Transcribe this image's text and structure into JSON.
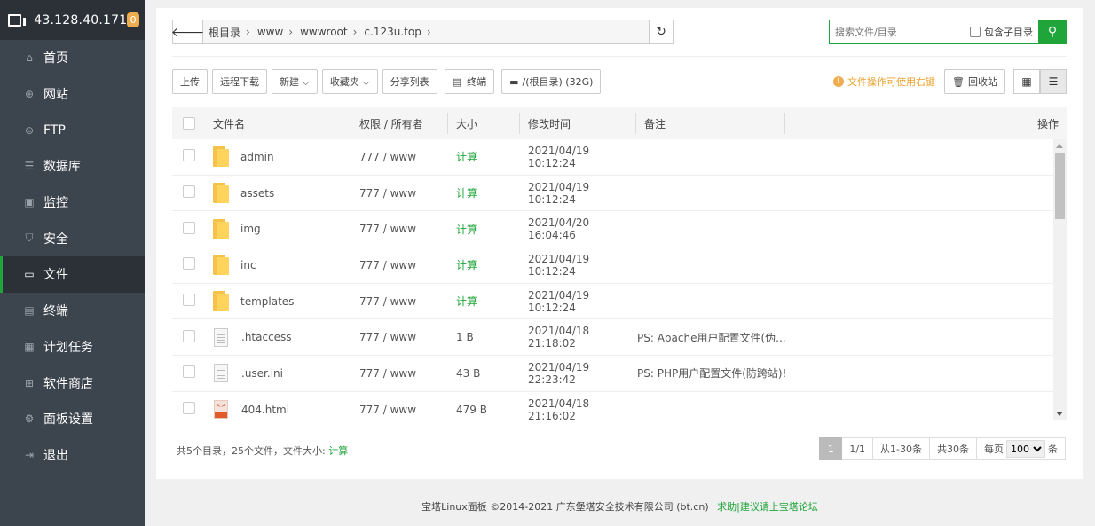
{
  "sidebar": {
    "ip": "43.128.40.171",
    "badge": "0",
    "items": [
      {
        "label": "首页",
        "icon": "home-icon",
        "glyph": "⌂"
      },
      {
        "label": "网站",
        "icon": "globe-icon",
        "glyph": "⊕"
      },
      {
        "label": "FTP",
        "icon": "ftp-icon",
        "glyph": "⊜"
      },
      {
        "label": "数据库",
        "icon": "database-icon",
        "glyph": "☰"
      },
      {
        "label": "监控",
        "icon": "monitor-icon",
        "glyph": "▣"
      },
      {
        "label": "安全",
        "icon": "shield-icon",
        "glyph": "⛉"
      },
      {
        "label": "文件",
        "icon": "folder-icon",
        "glyph": "▭"
      },
      {
        "label": "终端",
        "icon": "terminal-icon",
        "glyph": "▤"
      },
      {
        "label": "计划任务",
        "icon": "calendar-icon",
        "glyph": "▦"
      },
      {
        "label": "软件商店",
        "icon": "apps-icon",
        "glyph": "⊞"
      },
      {
        "label": "面板设置",
        "icon": "gear-icon",
        "glyph": "⚙"
      },
      {
        "label": "退出",
        "icon": "logout-icon",
        "glyph": "⇥"
      }
    ],
    "active_index": 6
  },
  "path": {
    "crumbs": [
      "根目录",
      "www",
      "wwwroot",
      "c.123u.top"
    ]
  },
  "search": {
    "placeholder": "搜索文件/目录",
    "include_sub_label": "包含子目录"
  },
  "toolbar": {
    "buttons": [
      "上传",
      "远程下载",
      "新建 ⌵",
      "收藏夹 ⌵",
      "分享列表"
    ],
    "terminal": "终端",
    "disk": "/(根目录) (32G)",
    "tip": "文件操作可使用右键",
    "recycle": "回收站"
  },
  "table": {
    "headers": {
      "name": "文件名",
      "perm": "权限 / 所有者",
      "size": "大小",
      "time": "修改时间",
      "note": "备注",
      "ops": "操作"
    },
    "rows": [
      {
        "type": "folder",
        "name": "admin",
        "perm": "777 / www",
        "size": "计算",
        "time": "2021/04/19 10:12:24",
        "note": ""
      },
      {
        "type": "folder",
        "name": "assets",
        "perm": "777 / www",
        "size": "计算",
        "time": "2021/04/19 10:12:24",
        "note": ""
      },
      {
        "type": "folder",
        "name": "img",
        "perm": "777 / www",
        "size": "计算",
        "time": "2021/04/20 16:04:46",
        "note": ""
      },
      {
        "type": "folder",
        "name": "inc",
        "perm": "777 / www",
        "size": "计算",
        "time": "2021/04/19 10:12:24",
        "note": ""
      },
      {
        "type": "folder",
        "name": "templates",
        "perm": "777 / www",
        "size": "计算",
        "time": "2021/04/19 10:12:24",
        "note": ""
      },
      {
        "type": "file",
        "name": ".htaccess",
        "perm": "777 / www",
        "size": "1 B",
        "time": "2021/04/18 21:18:02",
        "note": "PS: Apache用户配置文件(伪..."
      },
      {
        "type": "file",
        "name": ".user.ini",
        "perm": "777 / www",
        "size": "43 B",
        "time": "2021/04/19 22:23:42",
        "note": "PS: PHP用户配置文件(防跨站)!"
      },
      {
        "type": "html",
        "name": "404.html",
        "perm": "777 / www",
        "size": "479 B",
        "time": "2021/04/18 21:16:02",
        "note": ""
      }
    ]
  },
  "summary": {
    "text": "共5个目录，25个文件，文件大小:",
    "calc": "计算"
  },
  "pager": {
    "current": "1",
    "pages": "1/1",
    "range": "从1-30条",
    "total": "共30条",
    "per_page_label": "每页",
    "per_page_value": "100",
    "unit": "条"
  },
  "footer": {
    "text": "宝塔Linux面板 ©2014-2021 广东堡塔安全技术有限公司 (bt.cn)",
    "link": "求助|建议请上宝塔论坛"
  },
  "colors": {
    "accent": "#20a53a",
    "sidebar_bg": "#3c444d",
    "warning": "#f0ad4e"
  }
}
